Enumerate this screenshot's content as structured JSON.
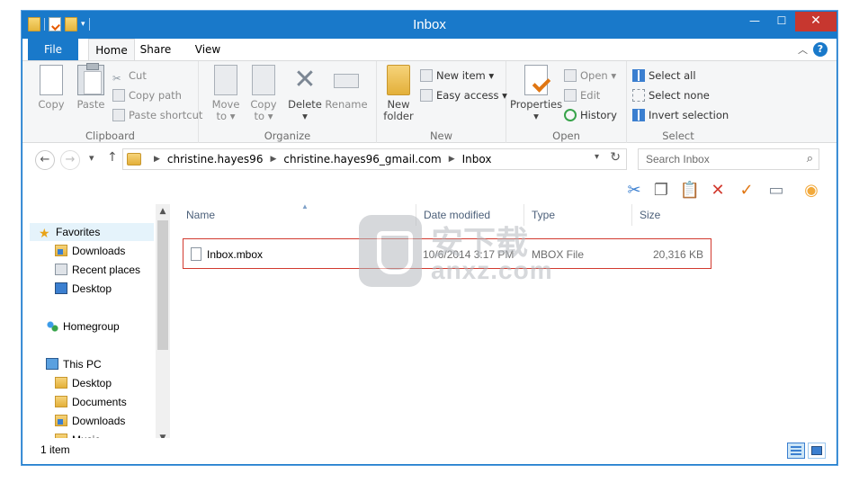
{
  "window": {
    "title": "Inbox"
  },
  "window_buttons": {
    "minimize": "—",
    "maximize": "☐",
    "close": "✕"
  },
  "ribbon_tabs": {
    "file": "File",
    "home": "Home",
    "share": "Share",
    "view": "View"
  },
  "ribbon": {
    "clipboard": {
      "label": "Clipboard",
      "copy": "Copy",
      "paste": "Paste",
      "cut": "Cut",
      "copy_path": "Copy path",
      "paste_shortcut": "Paste shortcut"
    },
    "organize": {
      "label": "Organize",
      "move_to": "Move",
      "move_to_2": "to ▾",
      "copy_to": "Copy",
      "copy_to_2": "to ▾",
      "delete": "Delete",
      "delete_2": "▾",
      "rename": "Rename"
    },
    "new": {
      "label": "New",
      "new_folder": "New",
      "new_folder_2": "folder",
      "new_item": "New item ▾",
      "easy_access": "Easy access ▾"
    },
    "open": {
      "label": "Open",
      "properties": "Properties",
      "properties_2": "▾",
      "open": "Open ▾",
      "edit": "Edit",
      "history": "History"
    },
    "select": {
      "label": "Select",
      "select_all": "Select all",
      "select_none": "Select none",
      "invert_selection": "Invert selection"
    }
  },
  "address": {
    "crumbs": [
      "christine.hayes96",
      "christine.hayes96_gmail.com",
      "Inbox"
    ],
    "search_placeholder": "Search Inbox"
  },
  "nav_pane": {
    "favorites": "Favorites",
    "downloads": "Downloads",
    "recent_places": "Recent places",
    "desktop": "Desktop",
    "homegroup": "Homegroup",
    "this_pc": "This PC",
    "pc_desktop": "Desktop",
    "documents": "Documents",
    "pc_downloads": "Downloads",
    "music": "Music"
  },
  "columns": {
    "name": "Name",
    "date_modified": "Date modified",
    "type": "Type",
    "size": "Size"
  },
  "files": [
    {
      "name": "Inbox.mbox",
      "date_modified": "10/6/2014 3:17 PM",
      "type": "MBOX File",
      "size": "20,316 KB"
    }
  ],
  "watermark": {
    "cn": "安下载",
    "text": "anxz.com"
  },
  "status": {
    "item_count": "1 item"
  },
  "colors": {
    "accent": "#1979ca",
    "close": "#c7372f",
    "highlight_border": "#d23a2f"
  }
}
